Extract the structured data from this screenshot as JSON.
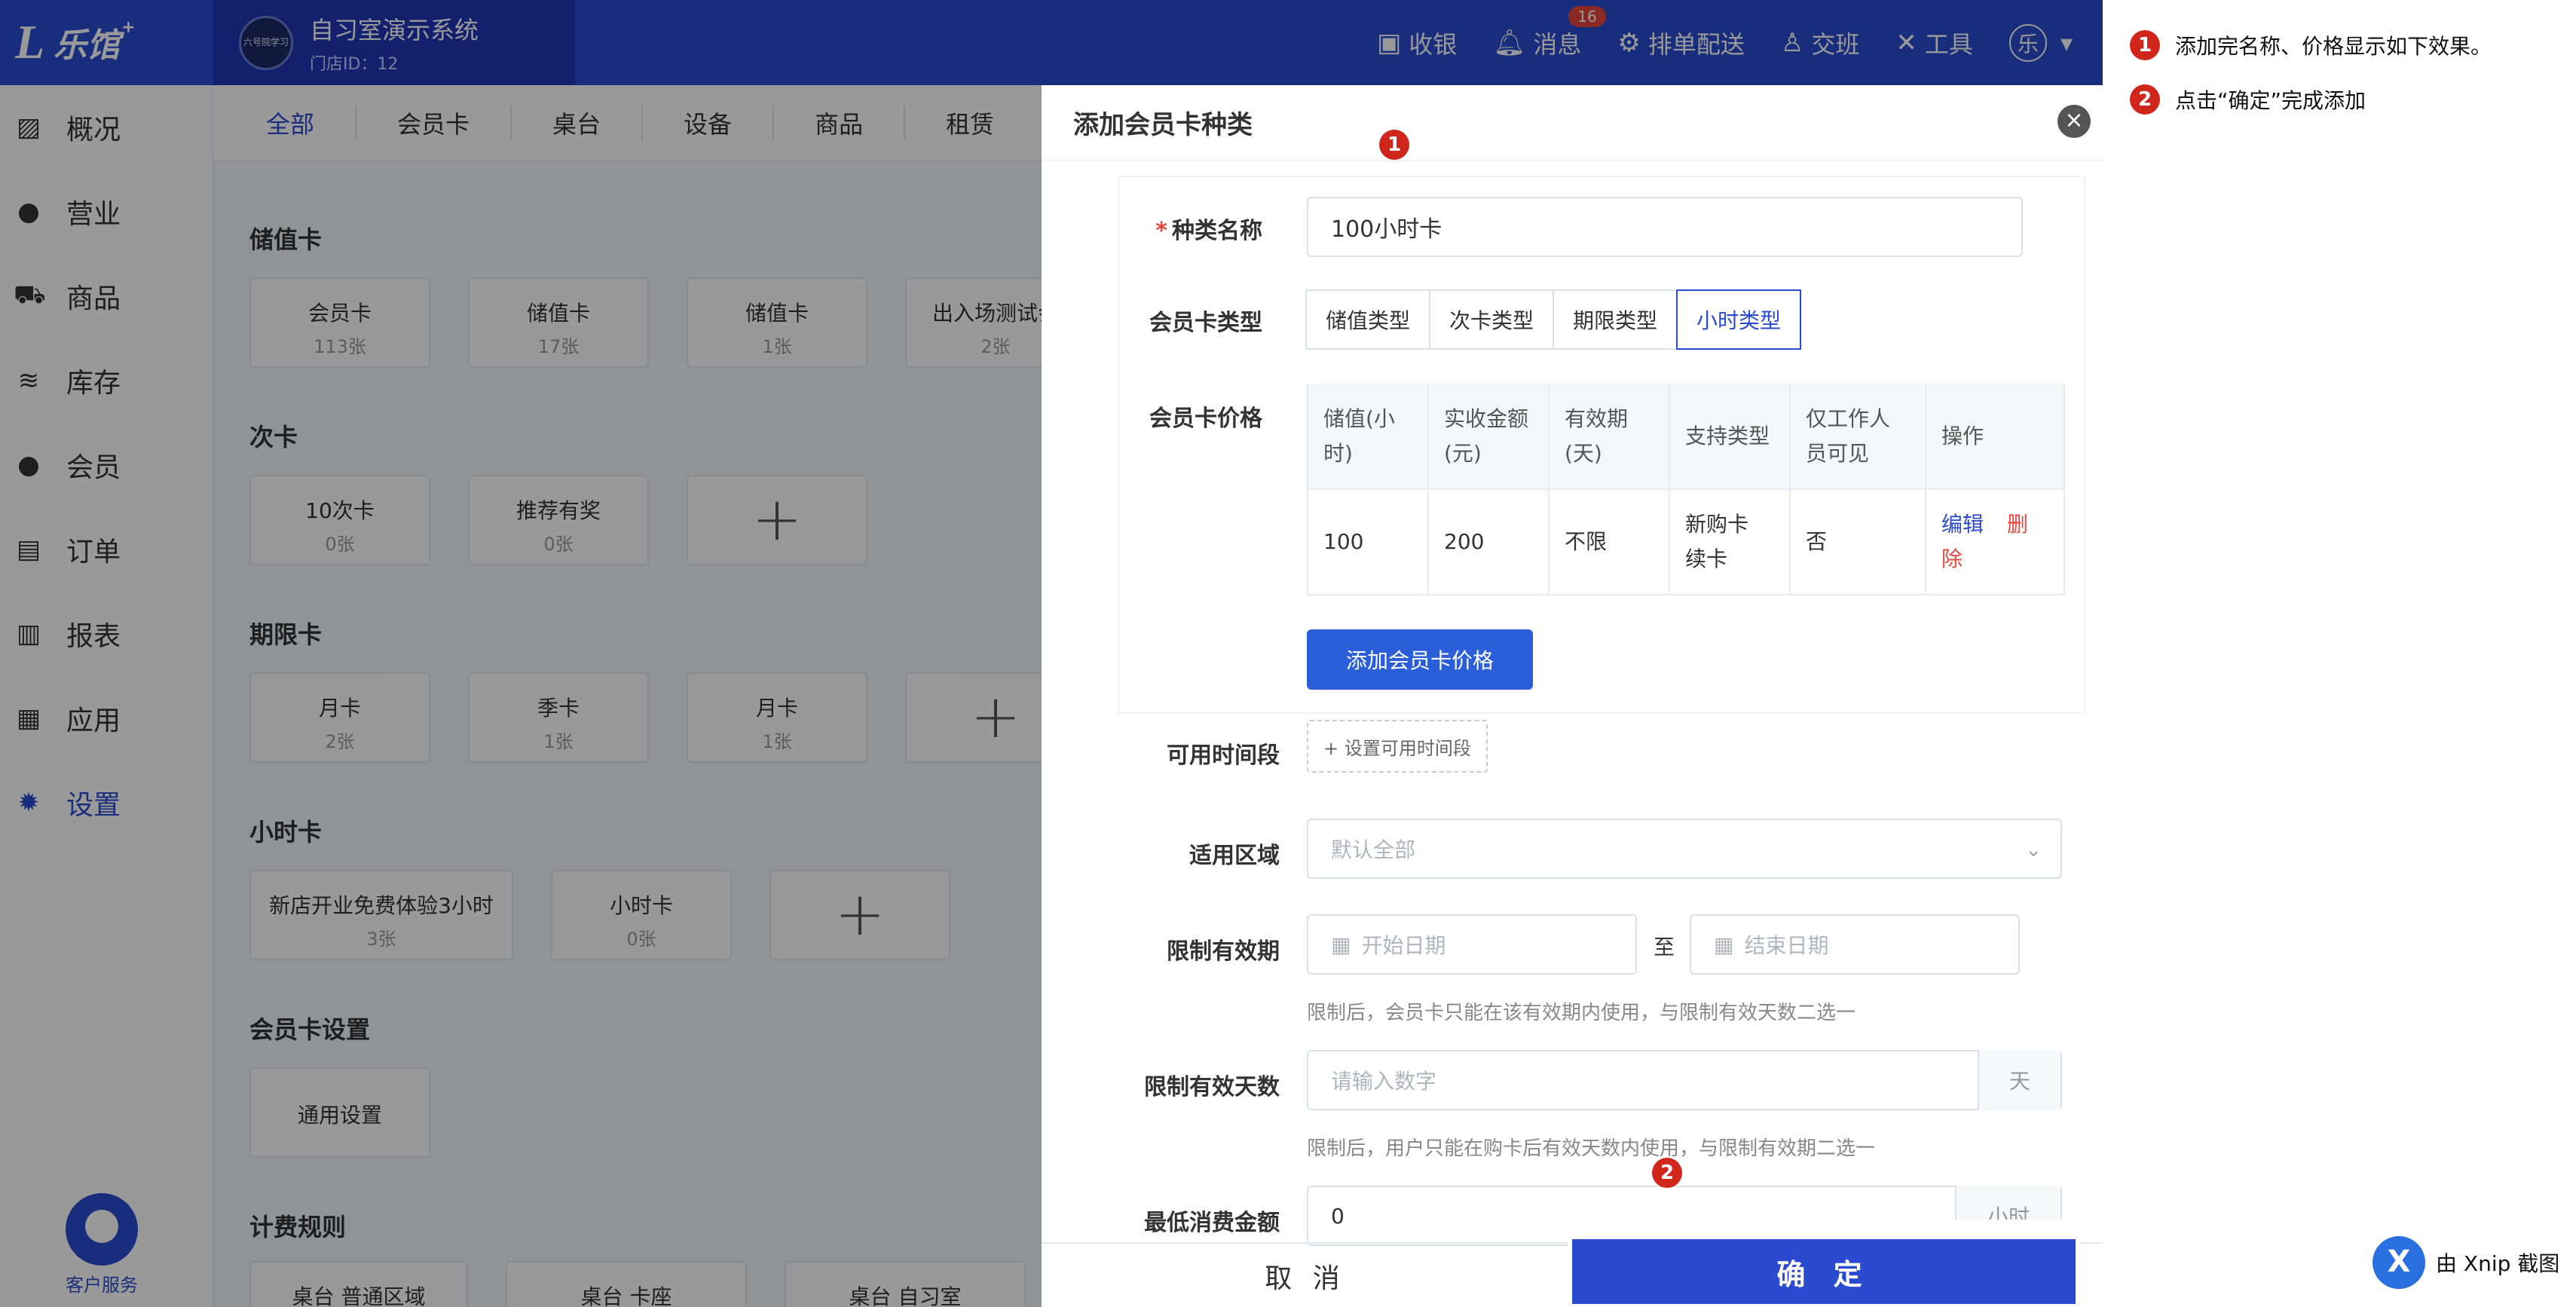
{
  "app": {
    "logo_mark": "L",
    "logo_text": "乐馆",
    "logo_sup": "+",
    "store_avatar_text": "六号院学习",
    "store_name": "自习室演示系统",
    "store_id": "门店ID：12"
  },
  "topmenu": {
    "cashier": "收银",
    "messages": "消息",
    "message_count": "16",
    "schedule": "排单配送",
    "shift": "交班",
    "tools": "工具",
    "user": "乐"
  },
  "sidebar": {
    "items": [
      {
        "label": "概况",
        "icon": "chart-icon"
      },
      {
        "label": "营业",
        "icon": "moneybag-icon"
      },
      {
        "label": "商品",
        "icon": "cart-icon"
      },
      {
        "label": "库存",
        "icon": "layers-icon"
      },
      {
        "label": "会员",
        "icon": "user-icon"
      },
      {
        "label": "订单",
        "icon": "order-icon"
      },
      {
        "label": "报表",
        "icon": "bar-chart-icon"
      },
      {
        "label": "应用",
        "icon": "apps-icon"
      },
      {
        "label": "设置",
        "icon": "gear-icon"
      }
    ],
    "service_label": "客户服务"
  },
  "tabs": [
    "全部",
    "会员卡",
    "桌台",
    "设备",
    "商品",
    "租赁"
  ],
  "sections": {
    "stored_title": "储值卡",
    "stored_cards": [
      {
        "name": "会员卡",
        "count": "113张"
      },
      {
        "name": "储值卡",
        "count": "17张"
      },
      {
        "name": "储值卡",
        "count": "1张"
      },
      {
        "name": "出入场测试会",
        "count": "2张"
      }
    ],
    "times_title": "次卡",
    "times_cards": [
      {
        "name": "10次卡",
        "count": "0张"
      },
      {
        "name": "推荐有奖",
        "count": "0张"
      }
    ],
    "period_title": "期限卡",
    "period_cards": [
      {
        "name": "月卡",
        "count": "2张"
      },
      {
        "name": "季卡",
        "count": "1张"
      },
      {
        "name": "月卡",
        "count": "1张"
      }
    ],
    "hour_title": "小时卡",
    "hour_cards": [
      {
        "name": "新店开业免费体验3小时",
        "count": "3张"
      },
      {
        "name": "小时卡",
        "count": "0张"
      }
    ],
    "settings_title": "会员卡设置",
    "settings_card": "通用设置",
    "billing_title": "计费规则",
    "billing_cards": [
      "桌台 普通区域",
      "桌台 卡座",
      "桌台 自习室"
    ],
    "plus": "+"
  },
  "drawer": {
    "title": "添加会员卡种类",
    "close": "×",
    "name_label": "种类名称",
    "name_required": "*",
    "name_value": "100小时卡",
    "type_label": "会员卡类型",
    "types": [
      "储值类型",
      "次卡类型",
      "期限类型",
      "小时类型"
    ],
    "price_label": "会员卡价格",
    "price_table": {
      "headers": [
        "储值(小时)",
        "实收金额(元)",
        "有效期(天)",
        "支持类型",
        "仅工作人员可见",
        "操作"
      ],
      "rows": [
        {
          "value": "100",
          "amount": "200",
          "validity": "不限",
          "support": "新购卡 续卡",
          "staff_only": "否",
          "edit": "编辑",
          "delete": "删除"
        }
      ]
    },
    "add_price_button": "添加会员卡价格",
    "time_label": "可用时间段",
    "time_button": "+ 设置可用时间段",
    "area_label": "适用区域",
    "area_placeholder": "默认全部",
    "period_label": "限制有效期",
    "start_placeholder": "开始日期",
    "to": "至",
    "end_placeholder": "结束日期",
    "period_hint": "限制后，会员卡只能在该有效期内使用，与限制有效天数二选一",
    "days_label": "限制有效天数",
    "days_placeholder": "请输入数字",
    "days_unit": "天",
    "days_hint": "限制后，用户只能在购卡后有效天数内使用，与限制有效期二选一",
    "min_label": "最低消费金额",
    "min_value": "0",
    "min_unit": "小时",
    "cancel": "取 消",
    "confirm": "确 定"
  },
  "markers": [
    "1",
    "2"
  ],
  "notes": [
    {
      "num": "1",
      "text": "添加完名称、价格显示如下效果。"
    },
    {
      "num": "2",
      "text": "点击“确定”完成添加"
    }
  ],
  "xnip": {
    "logo": "X",
    "text": "由 Xnip 截图"
  },
  "colors": {
    "brand": "#2a4bd0",
    "danger": "#e6453c",
    "marker": "#d0261c"
  }
}
